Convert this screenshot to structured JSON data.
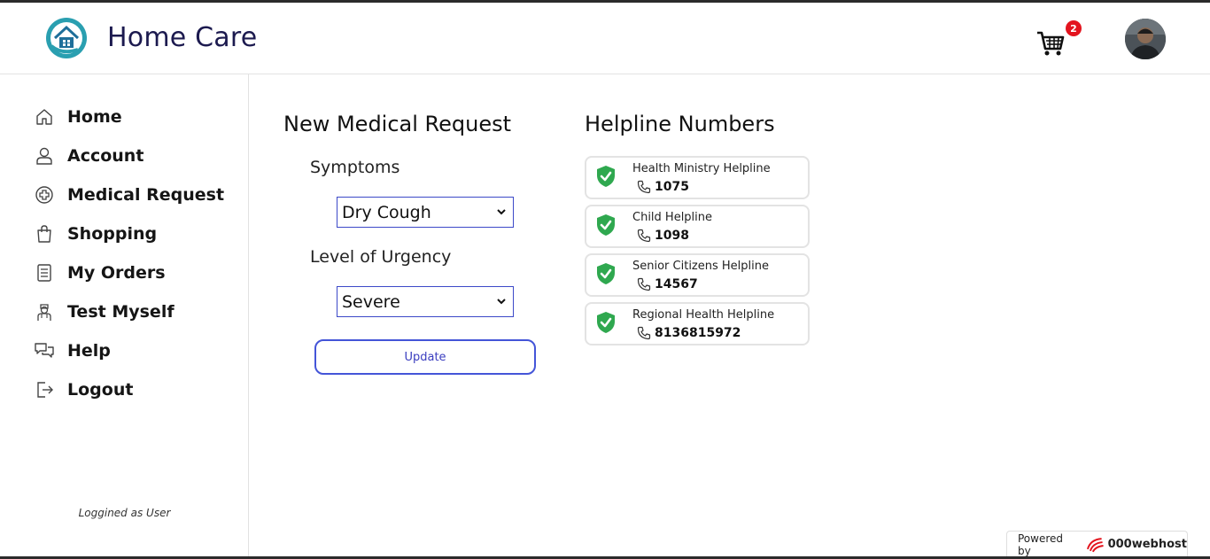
{
  "app": {
    "title": "Home Care"
  },
  "header": {
    "cart_count": "2"
  },
  "sidebar": {
    "items": [
      {
        "label": "Home"
      },
      {
        "label": "Account"
      },
      {
        "label": "Medical Request"
      },
      {
        "label": "Shopping"
      },
      {
        "label": "My Orders"
      },
      {
        "label": "Test Myself"
      },
      {
        "label": "Help"
      },
      {
        "label": "Logout"
      }
    ],
    "logged_as": "Loggined as User"
  },
  "request": {
    "title": "New Medical Request",
    "symptoms_label": "Symptoms",
    "symptoms_value": "Dry Cough",
    "urgency_label": "Level of Urgency",
    "urgency_value": "Severe",
    "update_label": "Update"
  },
  "helplines": {
    "title": "Helpline Numbers",
    "items": [
      {
        "name": "Health Ministry Helpline",
        "number": "1075"
      },
      {
        "name": "Child Helpline",
        "number": "1098"
      },
      {
        "name": "Senior Citizens Helpline",
        "number": "14567"
      },
      {
        "name": "Regional Health Helpline",
        "number": "8136815972"
      }
    ]
  },
  "footer": {
    "powered_by": "Powered by",
    "brand": "000webhost"
  },
  "colors": {
    "accent": "#4455d8",
    "title": "#1c1a4f",
    "shield": "#2fa84f",
    "badge": "#e3141e"
  }
}
